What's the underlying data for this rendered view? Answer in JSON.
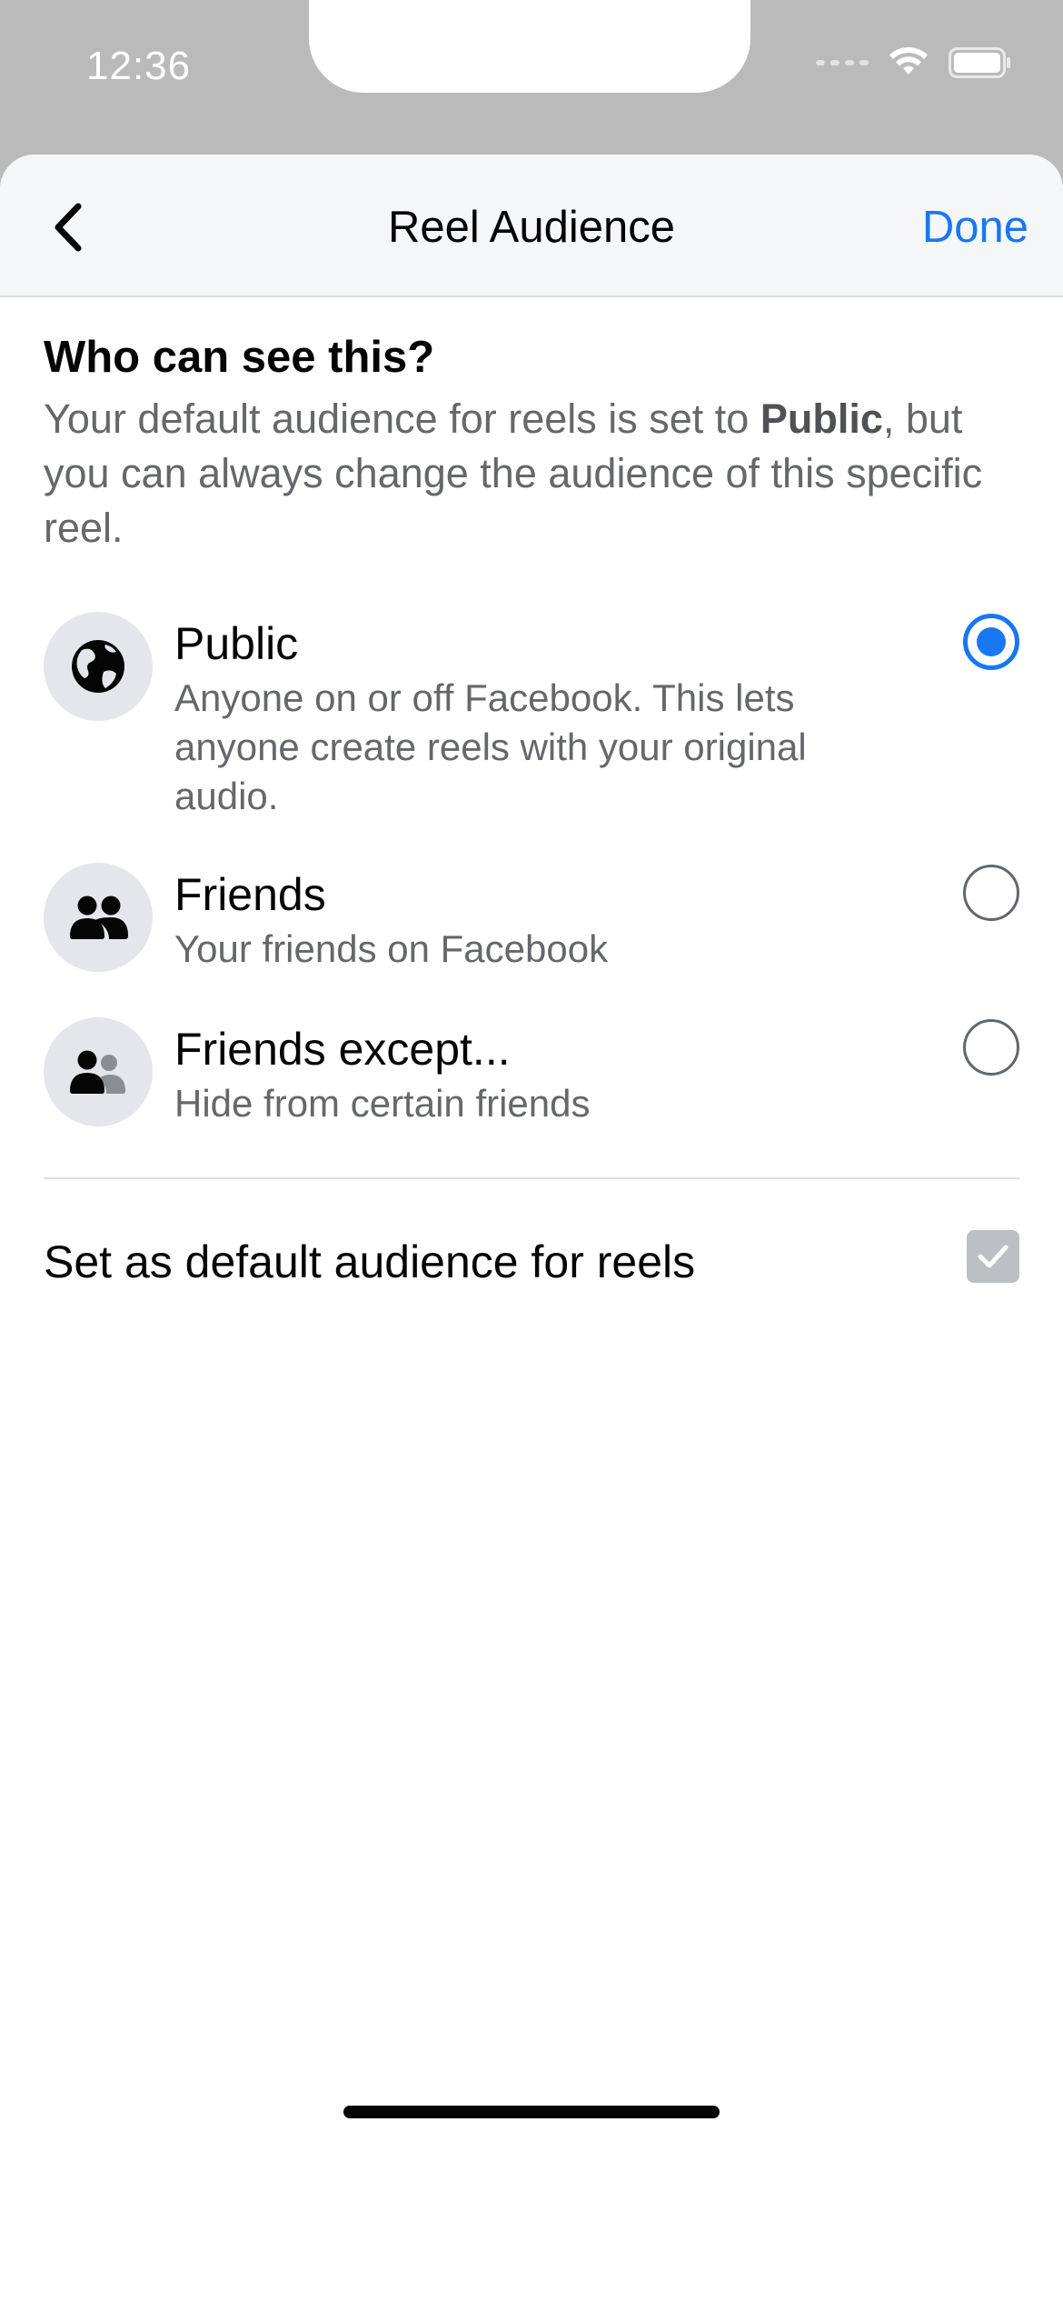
{
  "status_bar": {
    "time": "12:36"
  },
  "header": {
    "title": "Reel Audience",
    "done_label": "Done"
  },
  "main": {
    "heading": "Who can see this?",
    "description_prefix": "Your default audience for reels is set to ",
    "description_bold": "Public",
    "description_suffix": ", but you can always change the audience of this specific reel.",
    "options": [
      {
        "title": "Public",
        "subtitle": "Anyone on or off Facebook. This lets anyone create reels with your original audio.",
        "icon": "globe-icon",
        "selected": true
      },
      {
        "title": "Friends",
        "subtitle": "Your friends on Facebook",
        "icon": "friends-icon",
        "selected": false
      },
      {
        "title": "Friends except...",
        "subtitle": "Hide from certain friends",
        "icon": "friends-except-icon",
        "selected": false
      }
    ],
    "default_label": "Set as default audience for reels",
    "default_checked": true
  },
  "colors": {
    "accent": "#1877f2",
    "secondary_text": "#65676b",
    "icon_bg": "#e4e6eb"
  }
}
